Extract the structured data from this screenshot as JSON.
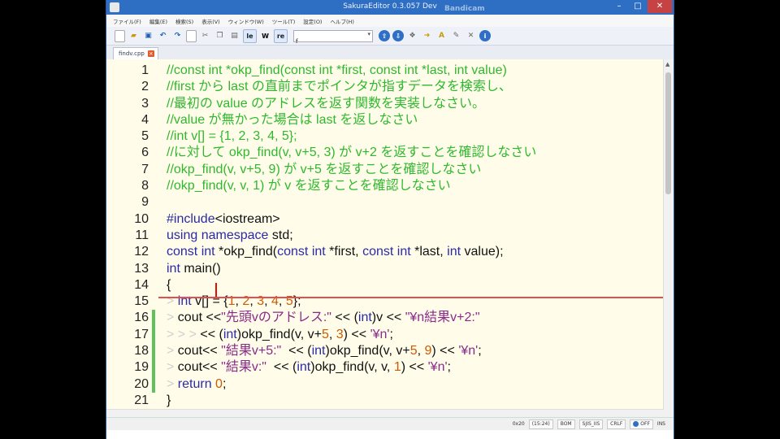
{
  "window": {
    "title": "SakuraEditor 0.3.057 Dev",
    "watermark": "Bandicam"
  },
  "menu": [
    "ファイル(F)",
    "編集(E)",
    "検索(S)",
    "表示(V)",
    "ウィンドウ(W)",
    "ツール(T)",
    "設定(O)",
    "ヘルプ(H)"
  ],
  "toolbar": {
    "search_value": "f",
    "icons": [
      "new-file-icon",
      "open-folder-icon",
      "save-icon",
      "undo-icon",
      "redo-icon",
      "blank-icon",
      "cut-icon",
      "copy-icon",
      "paste-icon",
      "case-icon",
      "word-icon",
      "regex-icon",
      "search-prev-icon",
      "search-next-icon",
      "grep-icon",
      "jump-icon",
      "settings-icon",
      "font-icon",
      "info-icon"
    ]
  },
  "tab": {
    "label": "findv.cpp"
  },
  "editor": {
    "lines": [
      {
        "n": "1",
        "segs": [
          [
            "c",
            "//const int *okp_find(const int *first, const int *last, int value)"
          ]
        ]
      },
      {
        "n": "2",
        "segs": [
          [
            "c",
            "//first から last の直前までポインタが指すデータを検索し、"
          ]
        ]
      },
      {
        "n": "3",
        "segs": [
          [
            "c",
            "//最初の value のアドレスを返す関数を実装しなさい。"
          ]
        ]
      },
      {
        "n": "4",
        "segs": [
          [
            "c",
            "//value が無かった場合は last を返しなさい"
          ]
        ]
      },
      {
        "n": "5",
        "segs": [
          [
            "c",
            "//int v[] = {1, 2, 3, 4, 5};"
          ]
        ]
      },
      {
        "n": "6",
        "segs": [
          [
            "c",
            "//に対して okp_find(v, v+5, 3) が v+2 を返すことを確認しなさい"
          ]
        ]
      },
      {
        "n": "7",
        "segs": [
          [
            "c",
            "//okp_find(v, v+5, 9) が v+5 を返すことを確認しなさい"
          ]
        ]
      },
      {
        "n": "8",
        "segs": [
          [
            "c",
            "//okp_find(v, v, 1) が v を返すことを確認しなさい"
          ]
        ]
      },
      {
        "n": "9",
        "segs": []
      },
      {
        "n": "10",
        "segs": [
          [
            "k",
            "#include"
          ],
          [
            "t",
            "<iostream>"
          ]
        ]
      },
      {
        "n": "11",
        "segs": [
          [
            "k",
            "using"
          ],
          [
            "t",
            " "
          ],
          [
            "k",
            "namespace"
          ],
          [
            "t",
            " std;"
          ]
        ]
      },
      {
        "n": "12",
        "segs": [
          [
            "k",
            "const"
          ],
          [
            "t",
            " "
          ],
          [
            "k",
            "int"
          ],
          [
            "t",
            " *okp_find("
          ],
          [
            "k",
            "const"
          ],
          [
            "t",
            " "
          ],
          [
            "k",
            "int"
          ],
          [
            "t",
            " *first, "
          ],
          [
            "k",
            "const"
          ],
          [
            "t",
            " "
          ],
          [
            "k",
            "int"
          ],
          [
            "t",
            " *last, "
          ],
          [
            "k",
            "int"
          ],
          [
            "t",
            " value);"
          ]
        ]
      },
      {
        "n": "13",
        "segs": [
          [
            "k",
            "int"
          ],
          [
            "t",
            " main()"
          ]
        ]
      },
      {
        "n": "14",
        "segs": [
          [
            "t",
            "{"
          ]
        ]
      },
      {
        "n": "15",
        "segs": [
          [
            "w",
            "> "
          ],
          [
            "k",
            "int"
          ],
          [
            "t",
            " v[] = {"
          ],
          [
            "n",
            "1"
          ],
          [
            "t",
            ", "
          ],
          [
            "n",
            "2"
          ],
          [
            "t",
            ", "
          ],
          [
            "n",
            "3"
          ],
          [
            "t",
            ", "
          ],
          [
            "n",
            "4"
          ],
          [
            "t",
            ", "
          ],
          [
            "n",
            "5"
          ],
          [
            "t",
            "};"
          ]
        ]
      },
      {
        "n": "16",
        "segs": [
          [
            "w",
            "> "
          ],
          [
            "t",
            "cout <<"
          ],
          [
            "s",
            "\"先頭vのアドレス:\""
          ],
          [
            "t",
            " << ("
          ],
          [
            "k",
            "int"
          ],
          [
            "t",
            ")v << "
          ],
          [
            "s",
            "\"¥n結果v+2:\""
          ]
        ]
      },
      {
        "n": "17",
        "segs": [
          [
            "w",
            "> > > "
          ],
          [
            "t",
            "<< ("
          ],
          [
            "k",
            "int"
          ],
          [
            "t",
            ")okp_find(v, v+"
          ],
          [
            "n",
            "5"
          ],
          [
            "t",
            ", "
          ],
          [
            "n",
            "3"
          ],
          [
            "t",
            ") << "
          ],
          [
            "s",
            "'¥n'"
          ],
          [
            "t",
            ";"
          ]
        ]
      },
      {
        "n": "18",
        "segs": [
          [
            "w",
            "> "
          ],
          [
            "t",
            "cout<< "
          ],
          [
            "s",
            "\"結果v+5:\""
          ],
          [
            "t",
            "  << ("
          ],
          [
            "k",
            "int"
          ],
          [
            "t",
            ")okp_find(v, v+"
          ],
          [
            "n",
            "5"
          ],
          [
            "t",
            ", "
          ],
          [
            "n",
            "9"
          ],
          [
            "t",
            ") << "
          ],
          [
            "s",
            "'¥n'"
          ],
          [
            "t",
            ";"
          ]
        ]
      },
      {
        "n": "19",
        "segs": [
          [
            "w",
            "> "
          ],
          [
            "t",
            "cout<< "
          ],
          [
            "s",
            "\"結果v:\""
          ],
          [
            "t",
            "  << ("
          ],
          [
            "k",
            "int"
          ],
          [
            "t",
            ")okp_find(v, v, "
          ],
          [
            "n",
            "1"
          ],
          [
            "t",
            ") << "
          ],
          [
            "s",
            "'¥n'"
          ],
          [
            "t",
            ";"
          ]
        ]
      },
      {
        "n": "20",
        "segs": [
          [
            "w",
            "> "
          ],
          [
            "k",
            "return"
          ],
          [
            "t",
            " "
          ],
          [
            "n",
            "0"
          ],
          [
            "t",
            ";"
          ]
        ]
      },
      {
        "n": "21",
        "segs": [
          [
            "t",
            "}"
          ]
        ]
      }
    ],
    "changed_lines": [
      "16",
      "17",
      "18",
      "19",
      "20"
    ]
  },
  "status": {
    "position": "0x20",
    "column": "(15:24)",
    "bom": "BOM",
    "encoding": "SJIS_IIS",
    "eol": "CRLF",
    "mode": "OFF",
    "ins": "INS"
  },
  "colors": {
    "comment": "#2fb82f",
    "keyword": "#2a2aa7",
    "string": "#8a2a8a",
    "number": "#cc5a00",
    "editor_bg": "#fffde9",
    "titlebar": "#2e6fc4"
  }
}
